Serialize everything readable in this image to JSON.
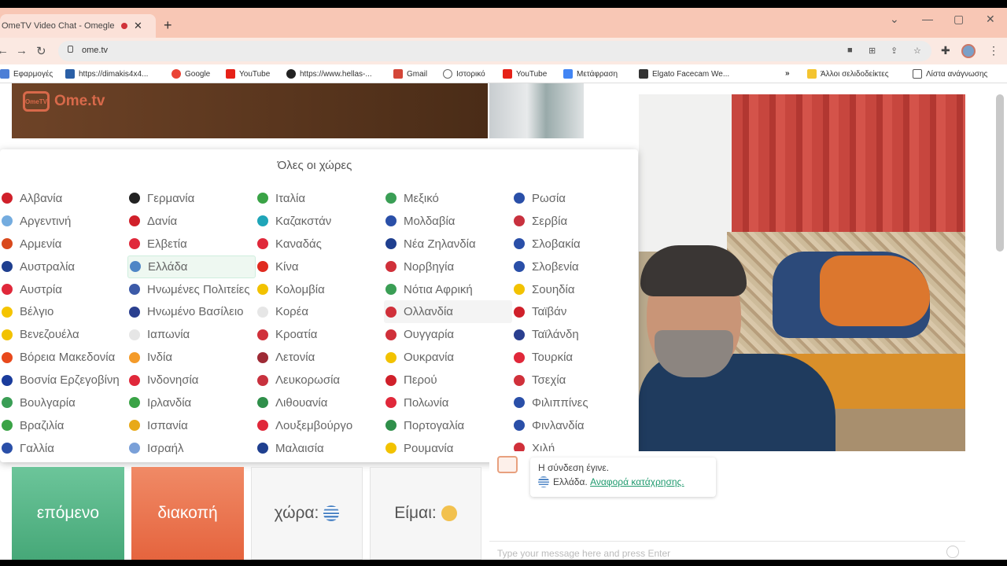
{
  "browser": {
    "tab_title": "OmeTV Video Chat - Omegle",
    "new_tab": "+",
    "url": "ome.tv",
    "window_controls": [
      "⌄",
      "—",
      "▢",
      "✕"
    ],
    "bookmarks": [
      {
        "label": "Εφαρμογές",
        "color": "#4d7fd6"
      },
      {
        "label": "https://dimakis4x4...",
        "color": "#2a5fa6"
      },
      {
        "label": "Google",
        "color": "#ea4335"
      },
      {
        "label": "YouTube",
        "color": "#e62117"
      },
      {
        "label": "https://www.hellas-...",
        "color": "#222222"
      },
      {
        "label": "Gmail",
        "color": "#d44638"
      },
      {
        "label": "Ιστορικό",
        "color": "#666666"
      },
      {
        "label": "YouTube",
        "color": "#e62117"
      },
      {
        "label": "Μετάφραση",
        "color": "#4285f4"
      },
      {
        "label": "Elgato Facecam We...",
        "color": "#333333"
      },
      {
        "label": "»",
        "color": "#ffffff"
      },
      {
        "label": "Άλλοι σελιδοδείκτες",
        "color": "#f4c430"
      },
      {
        "label": "Λίστα ανάγνωσης",
        "color": "#555555"
      }
    ]
  },
  "site": {
    "logo_tv": "OmeTV",
    "logo_text": "Ome.tv"
  },
  "countries": {
    "title": "Όλες οι χώρες",
    "selected": "Ελλάδα",
    "hovered": "Ολλανδία",
    "columns": [
      [
        {
          "name": "Αλβανία",
          "color": "#d0202a"
        },
        {
          "name": "Αργεντινή",
          "color": "#74acdf"
        },
        {
          "name": "Αρμενία",
          "color": "#d9491c"
        },
        {
          "name": "Αυστραλία",
          "color": "#1f3f8f"
        },
        {
          "name": "Αυστρία",
          "color": "#e0283a"
        },
        {
          "name": "Βέλγιο",
          "color": "#f5c400"
        },
        {
          "name": "Βενεζουέλα",
          "color": "#f2c200"
        },
        {
          "name": "Βόρεια Μακεδονία",
          "color": "#e8491c"
        },
        {
          "name": "Βοσνία Ερζεγοβίνη",
          "color": "#1a3c9c"
        },
        {
          "name": "Βουλγαρία",
          "color": "#3a9e55"
        },
        {
          "name": "Βραζιλία",
          "color": "#3aa346"
        },
        {
          "name": "Γαλλία",
          "color": "#2a4fa8"
        }
      ],
      [
        {
          "name": "Γερμανία",
          "color": "#222222"
        },
        {
          "name": "Δανία",
          "color": "#d0202a"
        },
        {
          "name": "Ελβετία",
          "color": "#e0283a"
        },
        {
          "name": "Ελλάδα",
          "color": "#4f86c6"
        },
        {
          "name": "Ηνωμένες Πολιτείες",
          "color": "#3c5aa8"
        },
        {
          "name": "Ηνωμένο Βασίλειο",
          "color": "#2a3f8f"
        },
        {
          "name": "Ιαπωνία",
          "color": "#e6e6e6"
        },
        {
          "name": "Ινδία",
          "color": "#f49b2a"
        },
        {
          "name": "Ινδονησία",
          "color": "#e0283a"
        },
        {
          "name": "Ιρλανδία",
          "color": "#3aa346"
        },
        {
          "name": "Ισπανία",
          "color": "#e8a917"
        },
        {
          "name": "Ισραήλ",
          "color": "#7aa0d8"
        }
      ],
      [
        {
          "name": "Ιταλία",
          "color": "#3aa346"
        },
        {
          "name": "Καζακστάν",
          "color": "#1fa5b8"
        },
        {
          "name": "Καναδάς",
          "color": "#e0283a"
        },
        {
          "name": "Κίνα",
          "color": "#e02a1f"
        },
        {
          "name": "Κολομβία",
          "color": "#f2c200"
        },
        {
          "name": "Κορέα",
          "color": "#e6e6e6"
        },
        {
          "name": "Κροατία",
          "color": "#d0303a"
        },
        {
          "name": "Λετονία",
          "color": "#9e2a35"
        },
        {
          "name": "Λευκορωσία",
          "color": "#c8313e"
        },
        {
          "name": "Λιθουανία",
          "color": "#2f8f4a"
        },
        {
          "name": "Λουξεμβούργο",
          "color": "#e0283a"
        },
        {
          "name": "Μαλαισία",
          "color": "#1f3f8f"
        }
      ],
      [
        {
          "name": "Μεξικό",
          "color": "#3a9e55"
        },
        {
          "name": "Μολδαβία",
          "color": "#2a4fa8"
        },
        {
          "name": "Νέα Ζηλανδία",
          "color": "#1f3f8f"
        },
        {
          "name": "Νορβηγία",
          "color": "#d0303a"
        },
        {
          "name": "Νότια Αφρική",
          "color": "#3a9e55"
        },
        {
          "name": "Ολλανδία",
          "color": "#d0303a"
        },
        {
          "name": "Ουγγαρία",
          "color": "#d0303a"
        },
        {
          "name": "Ουκρανία",
          "color": "#f2c200"
        },
        {
          "name": "Περού",
          "color": "#d0202a"
        },
        {
          "name": "Πολωνία",
          "color": "#e0283a"
        },
        {
          "name": "Πορτογαλία",
          "color": "#2f8f4a"
        },
        {
          "name": "Ρουμανία",
          "color": "#f2c200"
        }
      ],
      [
        {
          "name": "Ρωσία",
          "color": "#2a4fa8"
        },
        {
          "name": "Σερβία",
          "color": "#c8313e"
        },
        {
          "name": "Σλοβακία",
          "color": "#2a4fa8"
        },
        {
          "name": "Σλοβενία",
          "color": "#2a4fa8"
        },
        {
          "name": "Σουηδία",
          "color": "#f2c200"
        },
        {
          "name": "Ταϊβάν",
          "color": "#d0202a"
        },
        {
          "name": "Ταϊλάνδη",
          "color": "#2a3f8f"
        },
        {
          "name": "Τουρκία",
          "color": "#e0283a"
        },
        {
          "name": "Τσεχία",
          "color": "#d0303a"
        },
        {
          "name": "Φιλιππίνες",
          "color": "#2a4fa8"
        },
        {
          "name": "Φινλανδία",
          "color": "#2a4fa8"
        },
        {
          "name": "Χιλή",
          "color": "#d0303a"
        }
      ]
    ]
  },
  "controls": {
    "next": "επόμενο",
    "stop": "διακοπή",
    "country": "χώρα:",
    "me": "Είμαι:"
  },
  "chat": {
    "connected": "Η σύνδεση έγινε.",
    "country": "Ελλάδα.",
    "report": "Αναφορά κατάχρησης.",
    "input_placeholder": "Type your message here and press Enter"
  }
}
